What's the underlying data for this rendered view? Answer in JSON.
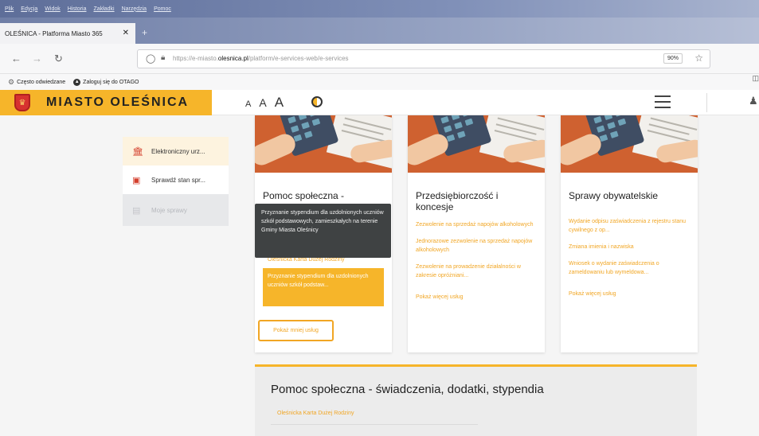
{
  "menubar": [
    "Plik",
    "Edycja",
    "Widok",
    "Historia",
    "Zakładki",
    "Narzędzia",
    "Pomoc"
  ],
  "tab": {
    "title": "OLEŚNICA - Platforma Miasto 365",
    "close": "✕",
    "new": "+"
  },
  "nav": {
    "url_prefix": "https://e-miasto.",
    "url_host": "olesnica.pl",
    "url_path": "/platform/e-services-web/e-services",
    "zoom": "90%"
  },
  "bookmarks": [
    "Często odwiedzane",
    "Zaloguj się do OTAGO"
  ],
  "header": {
    "brand": "MIASTO OLEŚNICA",
    "font_small": "A",
    "font_medium": "A",
    "font_large": "A"
  },
  "sidemenu": [
    {
      "label": "Elektroniczny urz...",
      "icon": "building-icon",
      "state": "active"
    },
    {
      "label": "Sprawdź stan spr...",
      "icon": "document-search-icon",
      "state": "normal"
    },
    {
      "label": "Moje sprawy",
      "icon": "folder-icon",
      "state": "disabled"
    }
  ],
  "cards": [
    {
      "title": "Pomoc społeczna -",
      "services_faded": "Oleśnicka Karta Dużej Rodziny",
      "services_highlight": "Przyznanie stypendium dla uzdolnionych uczniów szkół podstaw...",
      "button": "Pokaż mniej usług"
    },
    {
      "title": "Przedsiębiorczość i koncesje",
      "services": [
        "Zezwolenie na sprzedaż napojów alkoholowych",
        "Jednorazowe zezwolenie na sprzedaż napojów alkoholowych",
        "Zezwolenie na prowadzenie działalności w zakresie opróżniani..."
      ],
      "more": "Pokaż więcej usług"
    },
    {
      "title": "Sprawy obywatelskie",
      "services": [
        "Wydanie odpisu zaświadczenia z rejestru stanu cywilnego z op...",
        "Zmiana imienia i nazwiska",
        "Wniosek o wydanie zaświadczenia o zameldowaniu lub wymeldowa..."
      ],
      "more": "Pokaż więcej usług"
    }
  ],
  "tooltip": "Przyznanie stypendium dla uzdolnionych uczniów szkół podstawowych, zamieszkałych na terenie Gminy Miasta Oleśnicy",
  "section": {
    "title": "Pomoc społeczna - świadczenia, dodatki, stypendia",
    "first_item": "Oleśnicka Karta Dużej Rodziny"
  },
  "colors": {
    "accent": "#f6b52a",
    "service_link": "#f1a624",
    "tooltip_bg": "#3f4243",
    "card_image": "#cf6130"
  }
}
